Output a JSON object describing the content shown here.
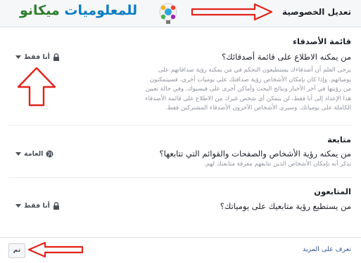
{
  "header": {
    "title": "تعديل الخصوصية"
  },
  "logo": {
    "word1": "ميكانو",
    "word2": "للمعلوميات"
  },
  "sections": [
    {
      "heading": "قائمة الأصدقاء",
      "question": "من يمكنه الاطلاع على قائمة أصدقائك؟",
      "desc": [
        "يرجى العلم أن أصدقاءك يستطيعون التحكم في من يمكنه رؤية صداقاتهم على",
        "يومياتهم. وإذا كان بإمكان الأشخاص رؤية صداقتك على يوميات أخرى، فسيتمكنون",
        "من رؤيتها في آخر الأخبار ونتائج البحث وأماكن أخرى على فيسبوك. وفي حالة تعيين",
        "هذا الإعداد إلى أنا فقط، لن يتمكن أي شخص غيرك من الاطلاع على قائمة الأصدقاء",
        "الكاملة على يومياتك. وسيرى الأشخاص الآخرون الأصدقاء المشتركين فقط."
      ],
      "audience": "أنا فقط"
    },
    {
      "heading": "متابعة",
      "question": "من يمكنه رؤية الأشخاص والصفحات والقوائم التي تتابعها؟",
      "desc": [
        "تذكر أنه بإمكان الأشخاص الذين تتابعهم معرفة متابعتك لهم."
      ],
      "audience": "العامة"
    },
    {
      "heading": "المتابعون",
      "question": "من يستطيع رؤية متابعيك على يومياتك؟",
      "desc": [],
      "audience": "أنا فقط"
    }
  ],
  "footer": {
    "done": "تم",
    "learn_more": "تعرف على المزيد"
  },
  "colors": {
    "arrow": "#e2231a",
    "link": "#385898"
  }
}
